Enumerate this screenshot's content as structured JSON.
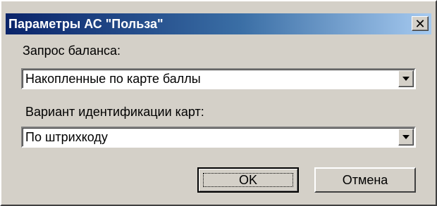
{
  "dialog": {
    "title": "Параметры АС \"Польза\"",
    "close_icon": "close-icon"
  },
  "balance": {
    "label": "Запрос баланса:",
    "value": "Накопленные по карте баллы"
  },
  "identification": {
    "label": "Вариант идентификации карт:",
    "value": "По штрихкоду"
  },
  "buttons": {
    "ok_label": "OK",
    "cancel_label": "Отмена"
  },
  "colors": {
    "window_bg": "#d4d0c8",
    "titlebar_start": "#0a246a",
    "titlebar_end": "#a6caf0"
  }
}
